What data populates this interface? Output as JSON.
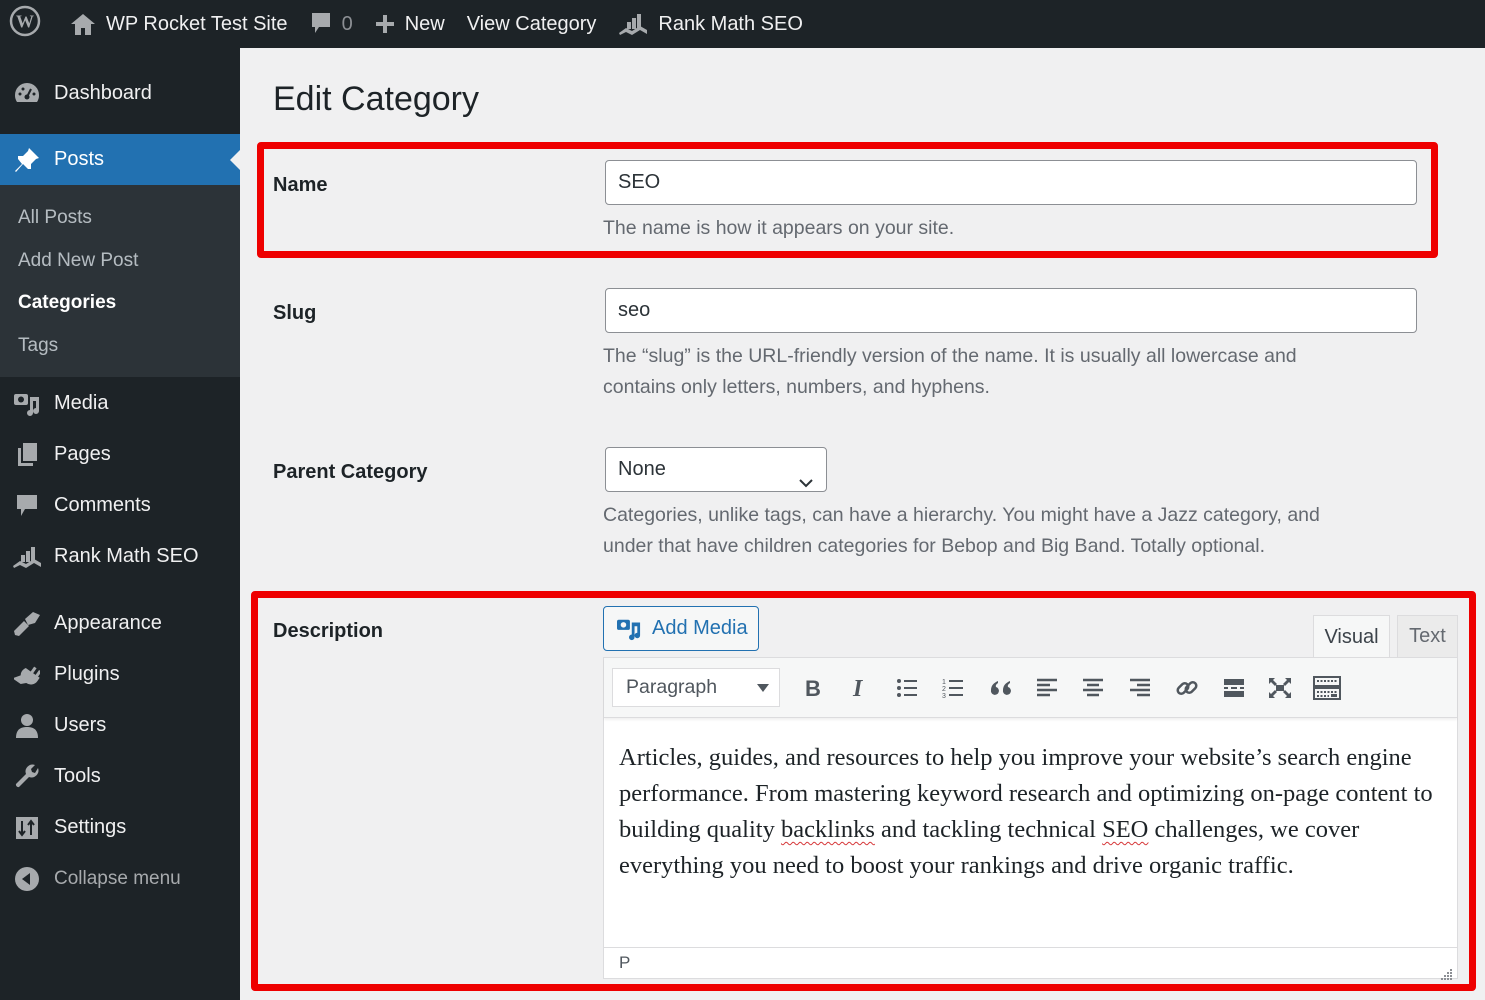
{
  "adminbar": {
    "site_name": "WP Rocket Test Site",
    "comments_count": "0",
    "new_label": "New",
    "view_label": "View Category",
    "rankmath_label": "Rank Math SEO"
  },
  "sidebar": {
    "items": [
      {
        "label": "Dashboard",
        "icon": "dashboard-icon"
      },
      {
        "label": "Posts",
        "icon": "pushpin-icon",
        "current": true
      },
      {
        "label": "Media",
        "icon": "media-icon"
      },
      {
        "label": "Pages",
        "icon": "pages-icon"
      },
      {
        "label": "Comments",
        "icon": "comment-icon"
      },
      {
        "label": "Rank Math SEO",
        "icon": "rankmath-icon"
      },
      {
        "label": "Appearance",
        "icon": "paintbrush-icon"
      },
      {
        "label": "Plugins",
        "icon": "plug-icon"
      },
      {
        "label": "Users",
        "icon": "user-icon"
      },
      {
        "label": "Tools",
        "icon": "wrench-icon"
      },
      {
        "label": "Settings",
        "icon": "settings-icon"
      }
    ],
    "posts_submenu": [
      {
        "label": "All Posts"
      },
      {
        "label": "Add New Post"
      },
      {
        "label": "Categories",
        "current": true
      },
      {
        "label": "Tags"
      }
    ],
    "collapse_label": "Collapse menu"
  },
  "page": {
    "title": "Edit Category",
    "name": {
      "label": "Name",
      "value": "SEO",
      "help": "The name is how it appears on your site."
    },
    "slug": {
      "label": "Slug",
      "value": "seo",
      "help_line1": "The “slug” is the URL-friendly version of the name. It is usually all lowercase and",
      "help_line2": "contains only letters, numbers, and hyphens."
    },
    "parent": {
      "label": "Parent Category",
      "selected": "None",
      "help_line1": "Categories, unlike tags, can have a hierarchy. You might have a Jazz category, and",
      "help_line2": "under that have children categories for Bebop and Big Band. Totally optional."
    },
    "description": {
      "label": "Description",
      "add_media_label": "Add Media",
      "tab_visual": "Visual",
      "tab_text": "Text",
      "format_selected": "Paragraph",
      "toolbar_buttons": [
        "bold",
        "italic",
        "bulleted-list",
        "numbered-list",
        "blockquote",
        "align-left",
        "align-center",
        "align-right",
        "insert-link",
        "read-more",
        "fullscreen",
        "toolbar-toggle"
      ],
      "content_part1": "Articles, guides, and resources to help you improve your website’s search engine performance. From mastering keyword research and optimizing on-page content to building quality ",
      "content_misspelled1": "backlinks",
      "content_part2": " and tackling technical ",
      "content_misspelled2": "SEO",
      "content_part3": " challenges, we cover everything you need to boost your rankings and drive organic traffic.",
      "status_path": "P"
    }
  },
  "colors": {
    "adminbar_bg": "#1d2327",
    "accent": "#2271b1",
    "highlight_border": "#ee0000",
    "page_bg": "#f0f0f1"
  }
}
